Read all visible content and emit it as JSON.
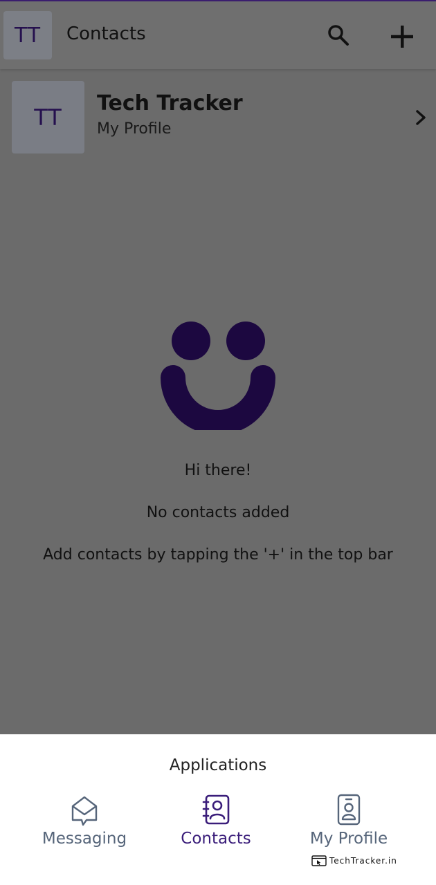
{
  "appbar": {
    "avatar_initials": "TT",
    "title": "Contacts",
    "search_icon": "search-icon",
    "add_icon": "plus-icon"
  },
  "profile": {
    "initials": "TT",
    "name": "Tech Tracker",
    "subtitle": "My Profile",
    "chevron_icon": "chevron-right-icon"
  },
  "empty_state": {
    "illustration": "smiley-icon",
    "greeting": "Hi there!",
    "message": "No contacts added",
    "hint": "Add contacts by tapping the '+' in the top bar"
  },
  "sheet": {
    "title": "Applications",
    "items": [
      {
        "label": "Messaging",
        "icon": "envelope-chat-icon",
        "selected": false
      },
      {
        "label": "Contacts",
        "icon": "address-book-icon",
        "selected": true
      },
      {
        "label": "My Profile",
        "icon": "id-badge-icon",
        "selected": false
      }
    ]
  },
  "watermark": "TechTracker.in",
  "colors": {
    "accent": "#3a1d7a",
    "smiley": "#1c0840",
    "scrim": "#6b6b6b",
    "inactive": "#56657a"
  }
}
